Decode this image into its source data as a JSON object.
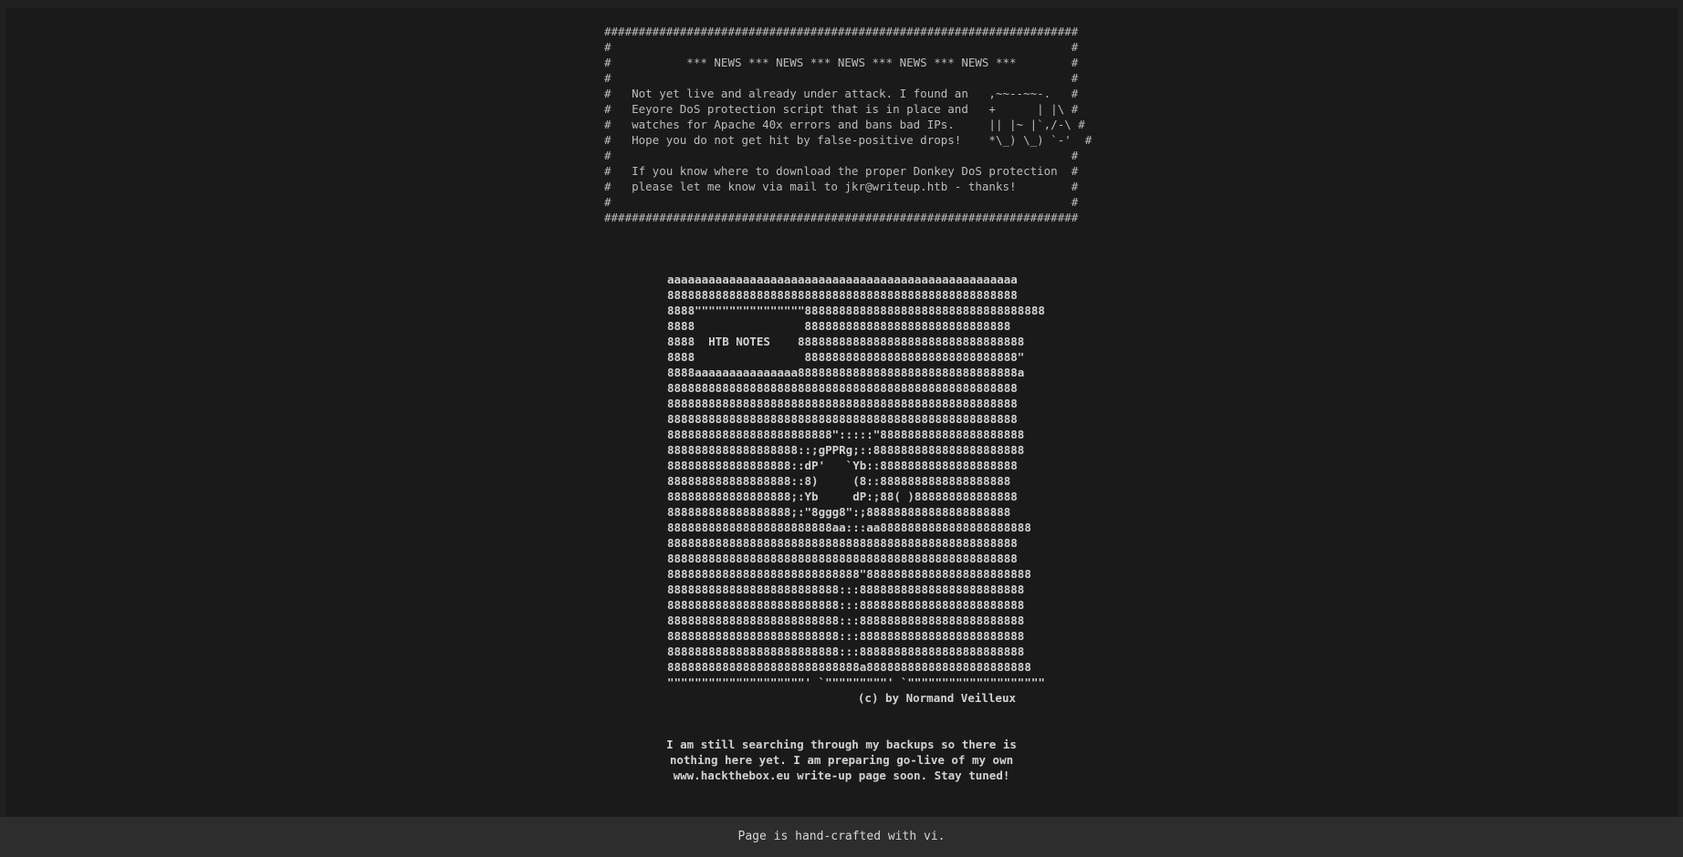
{
  "news_banner": "#####################################################################\n#                                                                   #\n#           *** NEWS *** NEWS *** NEWS *** NEWS *** NEWS ***        #\n#                                                                   #\n#   Not yet live and already under attack. I found an   ,~~--~~-.   #\n#   Eeyore DoS protection script that is in place and   +      | |\\ #\n#   watches for Apache 40x errors and bans bad IPs.     || |~ |`,/-\\ #\n#   Hope you do not get hit by false-positive drops!    *\\_) \\_) `-'  #\n#                                                                   #\n#   If you know where to download the proper Donkey DoS protection  #\n#   please let me know via mail to jkr@writeup.htb - thanks!        #\n#                                                                   #\n#####################################################################",
  "ascii_art": "aaaaaaaaaaaaaaaaaaaaaaaaaaaaaaaaaaaaaaaaaaaaaaaaaaa\n888888888888888888888888888888888888888888888888888\n8888\"\"\"\"\"\"\"\"\"\"\"\"\"\"\"\"88888888888888888888888888888888888\n8888                888888888888888888888888888888\n8888  HTB NOTES    888888888888888888888888888888888\n8888                8888888888888888888888888888888\"\n8888aaaaaaaaaaaaaaa88888888888888888888888888888888a\n888888888888888888888888888888888888888888888888888\n888888888888888888888888888888888888888888888888888\n888888888888888888888888888888888888888888888888888\n888888888888888888888888\":::::\"888888888888888888888\n8888888888888888888::;gPPRg;::8888888888888888888888\n888888888888888888::dP'   `Yb::88888888888888888888\n888888888888888888::8)     (8::8888888888888888888\n888888888888888888;:Yb     dP:;88( )888888888888888\n888888888888888888;:\"8ggg8\":;888888888888888888888\n888888888888888888888888aa:::aa8888888888888888888888\n888888888888888888888888888888888888888888888888888\n888888888888888888888888888888888888888888888888888\n8888888888888888888888888888\"888888888888888888888888\n8888888888888888888888888:::888888888888888888888888\n8888888888888888888888888:::888888888888888888888888\n8888888888888888888888888:::888888888888888888888888\n8888888888888888888888888:::888888888888888888888888\n8888888888888888888888888:::888888888888888888888888\n8888888888888888888888888888a888888888888888888888888\n\"\"\"\"\"\"\"\"\"\"\"\"\"\"\"\"\"\"\"\"' `\"\"\"\"\"\"\"\"\"' `\"\"\"\"\"\"\"\"\"\"\"\"\"\"\"\"\"\"\"\"",
  "credit": "(c) by Normand Veilleux",
  "message": "I am still searching through my backups so there is\nnothing here yet. I am preparing go-live of my own\nwww.hackthebox.eu write-up page soon. Stay tuned!",
  "footer": "Page is hand-crafted with vi."
}
